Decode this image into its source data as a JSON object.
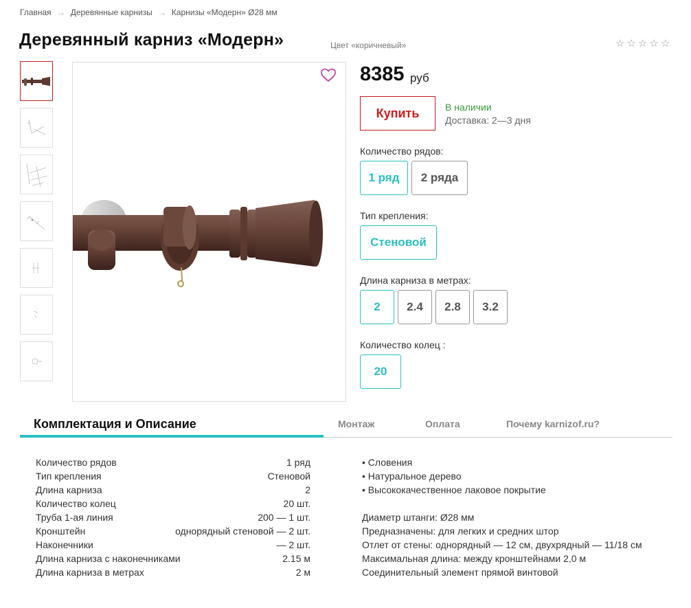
{
  "breadcrumb": [
    "Главная",
    "Деревянные карнизы",
    "Карнизы «Модерн» Ø28 мм"
  ],
  "breadcrumb_sep": "→",
  "product": {
    "title": "Деревянный карниз «Модерн»",
    "color_note": "Цвет «коричневый»",
    "rating": {
      "value": 0,
      "max": 5
    },
    "price": "8385",
    "price_unit": "руб",
    "buy_label": "Купить",
    "stock": "В наличии",
    "delivery": "Доставка: 2—3 дня",
    "thumbnails": 7
  },
  "options": {
    "rows": {
      "label": "Количество рядов:",
      "values": [
        "1 ряд",
        "2 ряда"
      ],
      "selected": "1 ряд"
    },
    "mount": {
      "label": "Тип крепления:",
      "values": [
        "Стеновой"
      ],
      "selected": "Стеновой"
    },
    "length": {
      "label": "Длина карниза в метрах:",
      "values": [
        "2",
        "2.4",
        "2.8",
        "3.2"
      ],
      "selected": "2"
    },
    "rings": {
      "label": "Количество колец :",
      "values": [
        "20"
      ],
      "selected": "20"
    }
  },
  "tabs": [
    "Комплектация и Описание",
    "Монтаж",
    "Оплата",
    "Почему karnizof.ru?"
  ],
  "active_tab": "Комплектация и Описание",
  "specs": [
    {
      "name": "Количество рядов",
      "value": "1 ряд"
    },
    {
      "name": "Тип крепления",
      "value": "Стеновой"
    },
    {
      "name": "Длина карниза",
      "value": "2"
    },
    {
      "name": "Количество колец",
      "value": "20 шт."
    },
    {
      "name": "Труба 1-ая линия",
      "value": "200 — 1 шт."
    },
    {
      "name": "Кронштейн",
      "value": "однорядный стеновой — 2 шт."
    },
    {
      "name": "Наконечники",
      "value": "— 2 шт."
    },
    {
      "name": "Длина карниза с наконечниками",
      "value": "2.15 м"
    },
    {
      "name": "Длина карниза в метрах",
      "value": "2 м"
    }
  ],
  "description": [
    "• Словения",
    "• Натуральное дерево",
    "• Высококачественное лаковое покрытие",
    "",
    "Диаметр штанги: Ø28 мм",
    "Предназначены: для легких и средних штор",
    "Отлет от стены:  однорядный — 12 см, двухрядный — 11/18 см",
    "Максимальная длина: между кронштейнами 2,0 м",
    "Соединительный элемент прямой винтовой"
  ],
  "colors": {
    "accent": "#2bbfbf",
    "buy": "#d21a1a",
    "stock": "#3a9a3a",
    "product_wood": "#5c3a30",
    "favorite": "#c0319a"
  }
}
